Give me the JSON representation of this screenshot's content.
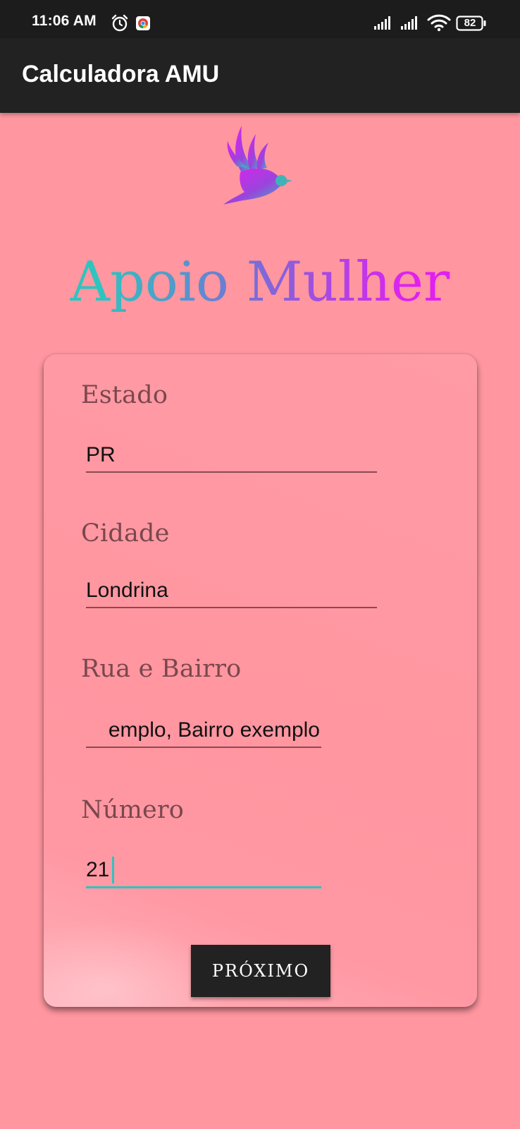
{
  "status_bar": {
    "time": "11:06 AM",
    "battery": "82",
    "icons": [
      "alarm-icon",
      "chrome-icon",
      "signal-icon",
      "signal-icon",
      "wifi-icon",
      "battery-icon"
    ]
  },
  "app_bar": {
    "title": "Calculadora AMU"
  },
  "brand": {
    "logo": "bird-icon",
    "title": "Apoio Mulher",
    "gradient_colors": [
      "#2ec4c0",
      "#8a5ae0",
      "#e020f0"
    ]
  },
  "form": {
    "fields": [
      {
        "label": "Estado",
        "value": "PR"
      },
      {
        "label": "Cidade",
        "value": "Londrina"
      },
      {
        "label": "Rua e Bairro",
        "value": "emplo, Bairro exemplo"
      },
      {
        "label": "Número",
        "value": "21"
      }
    ],
    "next_button": "PRÓXIMO"
  },
  "colors": {
    "background": "#FF96A0",
    "app_bar": "#222222",
    "label": "#7a474e",
    "focus_accent": "#2ec4c0"
  }
}
